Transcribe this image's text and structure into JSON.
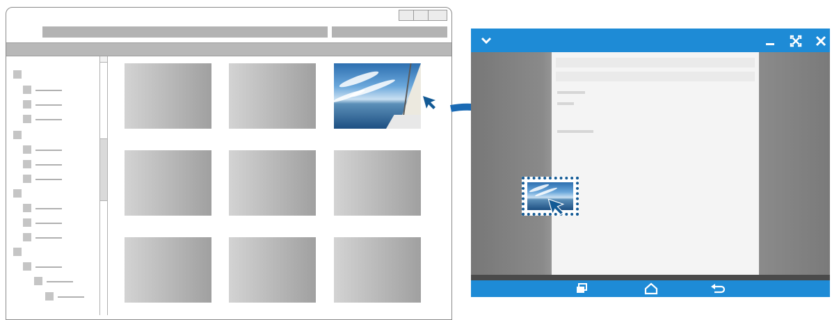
{
  "desktop_window": {
    "title_bar": {
      "controls": [
        "minimize-icon",
        "maximize-icon",
        "close-icon"
      ]
    },
    "tree": {
      "groups": [
        {
          "children": 3
        },
        {
          "children": 3
        },
        {
          "children": 3
        },
        {
          "children": 3
        }
      ]
    },
    "grid": {
      "thumbnails": 9,
      "selected_thumbnail": 3
    }
  },
  "device_window": {
    "title_bar": {
      "left_icon": "chevron-down-icon",
      "right_icons": [
        "minimize-icon",
        "fullscreen-icon",
        "close-icon"
      ]
    },
    "nav_bar": {
      "icons": [
        "recent-apps-icon",
        "home-icon",
        "back-icon"
      ]
    }
  },
  "drag_arrow": {
    "icon": "curved-arrow-icon",
    "color": "#1a6ab4"
  },
  "colors": {
    "accent": "#1e8bd6",
    "drop_border": "#135a95"
  }
}
